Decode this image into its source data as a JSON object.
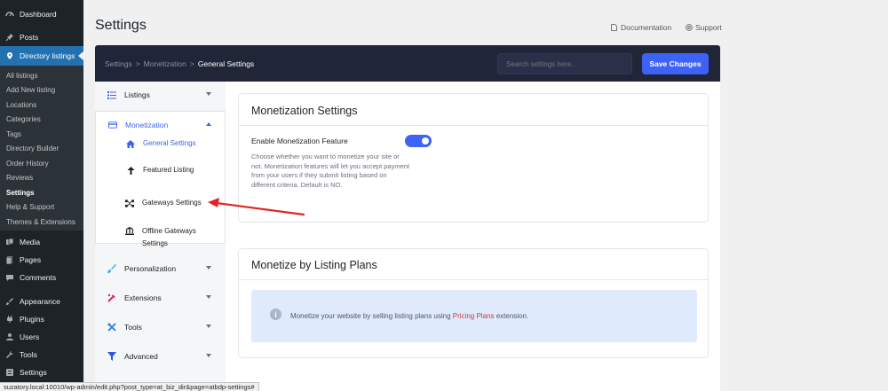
{
  "admin_menu": {
    "items": [
      {
        "label": "Dashboard",
        "icon": "dashboard-icon"
      },
      {
        "label": "Posts",
        "icon": "pin-icon"
      },
      {
        "label": "Directory listings",
        "icon": "location-icon"
      },
      {
        "label": "Media",
        "icon": "media-icon"
      },
      {
        "label": "Pages",
        "icon": "page-icon"
      },
      {
        "label": "Comments",
        "icon": "comment-icon"
      },
      {
        "label": "Appearance",
        "icon": "brush-icon"
      },
      {
        "label": "Plugins",
        "icon": "plug-icon"
      },
      {
        "label": "Users",
        "icon": "user-icon"
      },
      {
        "label": "Tools",
        "icon": "wrench-icon"
      },
      {
        "label": "Settings",
        "icon": "settings-icon"
      }
    ],
    "submenu": [
      "All listings",
      "Add New listing",
      "Locations",
      "Categories",
      "Tags",
      "Directory Builder",
      "Order History",
      "Reviews",
      "Settings",
      "Help & Support",
      "Themes & Extensions"
    ]
  },
  "header": {
    "title": "Settings",
    "documentation": "Documentation",
    "support": "Support"
  },
  "topbar": {
    "crumb_1": "Settings",
    "crumb_2": "Monetization",
    "crumb_3": "General Settings",
    "separator": ">",
    "search_placeholder": "Search settings here...",
    "save_label": "Save Changes"
  },
  "nav": {
    "listings": "Listings",
    "monetization": "Monetization",
    "general_settings": "General Settings",
    "featured_listing": "Featured Listing",
    "gateways_settings": "Gateways Settings",
    "offline_gateways_1": "Offline Gateways",
    "offline_gateways_2": "Settings",
    "personalization": "Personalization",
    "extensions": "Extensions",
    "tools": "Tools",
    "advanced": "Advanced"
  },
  "monetization_card": {
    "title": "Monetization Settings",
    "field_label": "Enable Monetization Feature",
    "field_desc": "Choose whether you want to monetize your site or not. Monetization features will let you accept payment from your users if they submit listing based on different criteria. Default is NO.",
    "enabled": true
  },
  "plans_card": {
    "title": "Monetize by Listing Plans",
    "info_prefix": "Monetize your website by selling listing plans using",
    "info_link": "Pricing Plans",
    "info_suffix": "extension."
  },
  "statusbar": {
    "url": "suzatory.local:10010/wp-admin/edit.php?post_type=at_biz_dir&page=atbdp-settings#"
  },
  "colors": {
    "accent": "#3e62f5",
    "dark_bar": "#202538",
    "wp_sidebar": "#1d2327",
    "arrow": "#e02424"
  }
}
